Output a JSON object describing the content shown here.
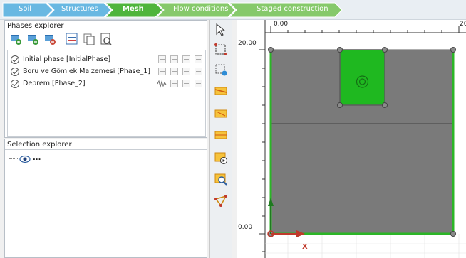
{
  "mode_tabs": [
    {
      "label": "Soil",
      "active": false
    },
    {
      "label": "Structures",
      "active": false
    },
    {
      "label": "Mesh",
      "active": true
    },
    {
      "label": "Flow conditions",
      "active": false
    },
    {
      "label": "Staged construction",
      "active": false
    }
  ],
  "phases_explorer": {
    "title": "Phases explorer",
    "toolbar_icons": [
      "add-phase-icon",
      "insert-phase-icon",
      "delete-phase-icon",
      "edit-phase-icon",
      "copy-phase-icon",
      "phase-settings-icon"
    ],
    "phases": [
      {
        "label": "Initial phase [InitialPhase]"
      },
      {
        "label": "Boru ve Gömlek Malzemesi [Phase_1]"
      },
      {
        "label": "Deprem [Phase_2]"
      }
    ]
  },
  "selection_explorer": {
    "title": "Selection explorer",
    "root_item": "..."
  },
  "canvas": {
    "top_ruler_labels": [
      "0.00",
      "20"
    ],
    "left_ruler_labels": [
      "20.00",
      "0.00"
    ],
    "axis_label_x": "X"
  },
  "colors": {
    "active_tab": "#4fb53c",
    "inactive_tab": "#69b8e2",
    "later_tab": "#86c96b",
    "soil_fill": "#7a7a7a",
    "structure_fill": "#1fb820",
    "boundary": "#2bb526"
  }
}
